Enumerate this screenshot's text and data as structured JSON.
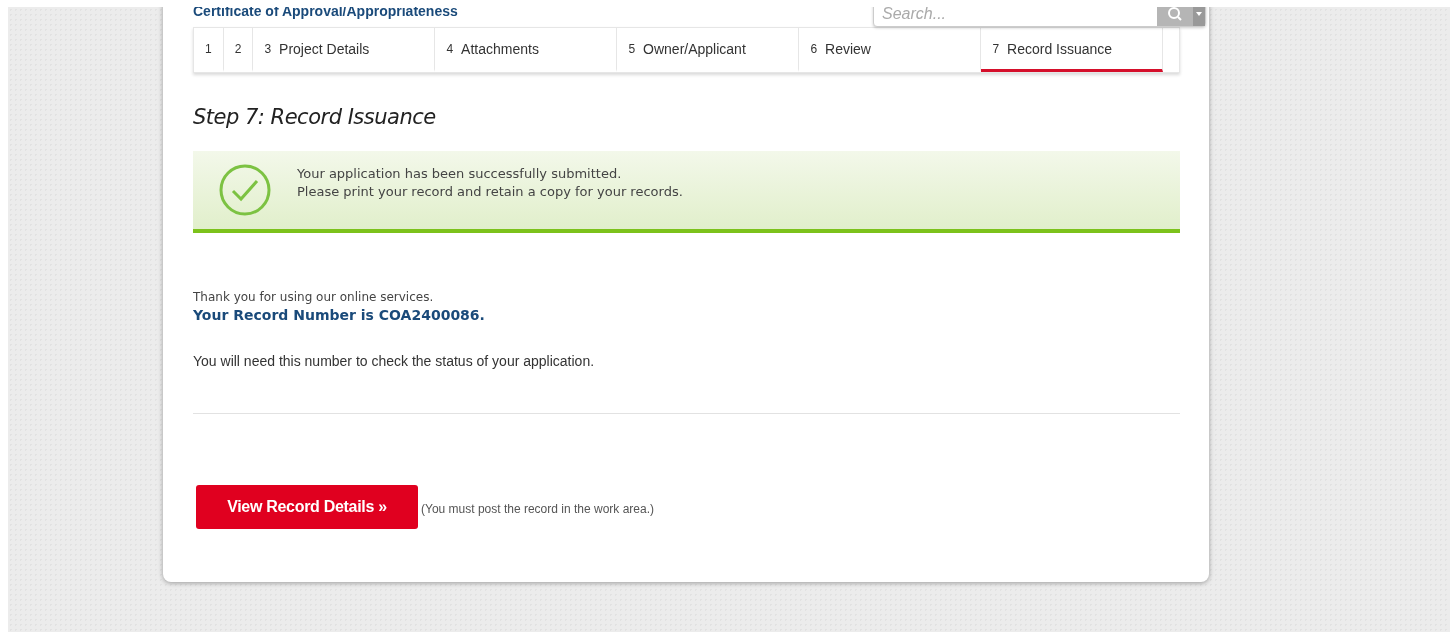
{
  "page_title": "Certificate of Approval/Appropriateness",
  "search": {
    "placeholder": "Search..."
  },
  "steps": [
    {
      "number": "1",
      "selected": false
    },
    {
      "number": "2",
      "selected": false
    },
    {
      "number": "3",
      "label": "Project Details",
      "selected": false
    },
    {
      "number": "4",
      "label": "Attachments",
      "selected": false
    },
    {
      "number": "5",
      "label": "Owner/Applicant",
      "selected": false
    },
    {
      "number": "6",
      "label": "Review",
      "selected": false
    },
    {
      "number": "7",
      "label": "Record Issuance",
      "selected": true
    }
  ],
  "step_heading": "Step 7: Record Issuance",
  "success_message": {
    "lines": [
      "Your application has been successfully submitted.",
      "Please print your record and retain a copy for your records."
    ]
  },
  "thank_you": "Thank you for using our online services.",
  "record_number": "Your Record Number is COA2400086.",
  "status_note": "You will need this number to check the status of your application.",
  "view_button": "View Record Details »",
  "work_area_note": "(You must post the record in the work area.)"
}
